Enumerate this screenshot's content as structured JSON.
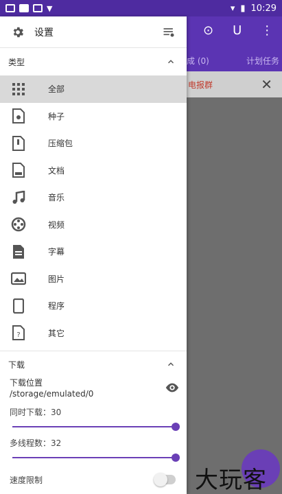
{
  "status_bar": {
    "time": "10:29"
  },
  "drawer": {
    "settings_label": "设置",
    "category_section_title": "类型",
    "categories": [
      {
        "label": "全部",
        "icon": "grid-icon",
        "selected": true
      },
      {
        "label": "种子",
        "icon": "torrent-file-icon"
      },
      {
        "label": "压缩包",
        "icon": "archive-file-icon"
      },
      {
        "label": "文档",
        "icon": "document-icon"
      },
      {
        "label": "音乐",
        "icon": "music-note-icon"
      },
      {
        "label": "视频",
        "icon": "video-reel-icon"
      },
      {
        "label": "字幕",
        "icon": "subtitle-file-icon"
      },
      {
        "label": "图片",
        "icon": "image-icon"
      },
      {
        "label": "程序",
        "icon": "phone-app-icon"
      },
      {
        "label": "其它",
        "icon": "unknown-file-icon"
      }
    ],
    "download_section_title": "下载",
    "download_location_label": "下载位置",
    "download_location_path": "/storage/emulated/0",
    "concurrent_downloads_label": "同时下载：30",
    "concurrent_downloads_value": 30,
    "concurrent_downloads_fraction": 1.0,
    "threads_label": "多线程数：32",
    "threads_value": 32,
    "threads_fraction": 1.0,
    "speed_limit_label": "速度限制",
    "speed_limit_enabled": false
  },
  "background_app": {
    "tab_fragment_1": "成 (0)",
    "tab_fragment_2": "计划任务",
    "banner_text": "电报群"
  },
  "watermark": "大玩客",
  "colors": {
    "accent": "#6a3fb6",
    "status_bar": "#4e2ba0",
    "banner_text": "#c0392b"
  }
}
